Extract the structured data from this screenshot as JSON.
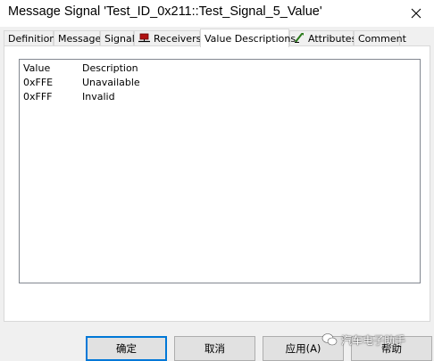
{
  "window": {
    "title": "Message Signal 'Test_ID_0x211::Test_Signal_5_Value'"
  },
  "tabs": [
    {
      "label": "Definition",
      "icon": null
    },
    {
      "label": "Message",
      "icon": null
    },
    {
      "label": "Signal",
      "icon": null
    },
    {
      "label": "Receivers",
      "icon": "ecu-node-icon"
    },
    {
      "label": "Value Descriptions",
      "icon": null,
      "active": true
    },
    {
      "label": "Attributes",
      "icon": "attributes-icon"
    },
    {
      "label": "Comment",
      "icon": null
    }
  ],
  "value_table": {
    "columns": [
      "Value",
      "Description"
    ],
    "rows": [
      {
        "value": "0xFFE",
        "description": "Unavailable"
      },
      {
        "value": "0xFFF",
        "description": "Invalid"
      }
    ]
  },
  "buttons": {
    "ok": "确定",
    "cancel": "取消",
    "apply": "应用(A)",
    "help": "帮助"
  },
  "watermark": {
    "text": "汽车电子助手"
  },
  "colors": {
    "focus_border": "#0078d7",
    "button_face": "#e1e1e1",
    "dialog_bg": "#f0f0f0"
  }
}
